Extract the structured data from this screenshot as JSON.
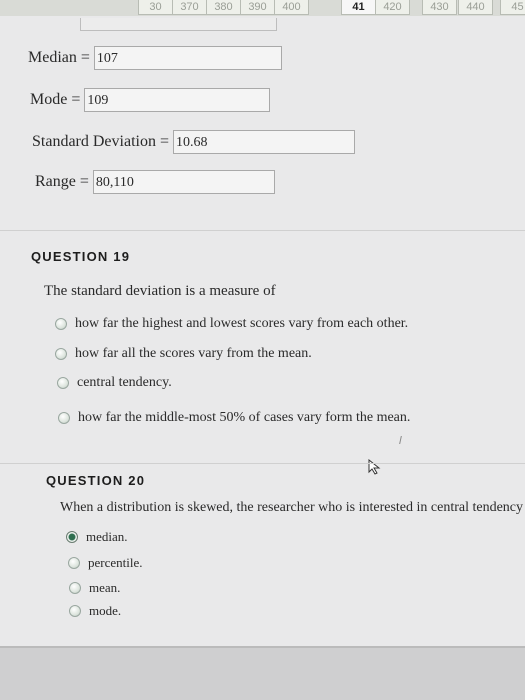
{
  "nav": {
    "tabs": [
      "30",
      "370",
      "380",
      "390",
      "400",
      "41",
      "420",
      "430",
      "440",
      "45"
    ],
    "current_index": 5
  },
  "answers": {
    "median": {
      "label": "Median",
      "value": "107"
    },
    "mode": {
      "label": "Mode",
      "value": "109"
    },
    "sd": {
      "label": "Standard Deviation",
      "value": "10.68"
    },
    "range": {
      "label": "Range",
      "value": "80,110"
    },
    "equals": "="
  },
  "q19": {
    "title": "QUESTION 19",
    "prompt": "The standard deviation is a measure of",
    "options": [
      "how far the highest and lowest scores vary from each other.",
      "how far all the scores vary from the mean.",
      "central tendency.",
      "how far the middle-most 50% of cases vary form the mean."
    ]
  },
  "q20": {
    "title": "QUESTION 20",
    "prompt": "When a distribution is skewed, the researcher who is interested in central tendency",
    "options": [
      "median.",
      "percentile.",
      "mean.",
      "mode."
    ],
    "selected_index": 0
  },
  "colors": {
    "page_bg": "#e9e9ea",
    "radio_selected": "#2f6f50"
  },
  "icons": {
    "cursor": "mouse-pointer-icon"
  }
}
